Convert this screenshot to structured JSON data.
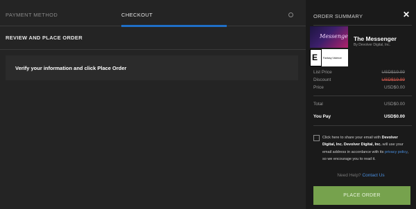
{
  "tabs": {
    "payment_method": "PAYMENT METHOD",
    "checkout": "CHECKOUT"
  },
  "main": {
    "section_title": "REVIEW AND PLACE ORDER",
    "verify_text": "Verify your information and click Place Order"
  },
  "summary": {
    "title": "ORDER SUMMARY",
    "close_icon": "close-icon",
    "product": {
      "title": "The Messenger",
      "publisher": "By Devolver Digital, Inc.",
      "cover_text": "Messenger",
      "esrb_rating": "E10+",
      "esrb_descriptor": "Fantasy Violence"
    },
    "prices": {
      "list_price_label": "List Price",
      "list_price_value": "USD$19.99",
      "discount_label": "Discount",
      "discount_value": "USD$19.99",
      "price_label": "Price",
      "price_value": "USD$0.00",
      "total_label": "Total",
      "total_value": "USD$0.00",
      "you_pay_label": "You Pay",
      "you_pay_value": "USD$0.00"
    },
    "consent": {
      "part1": "Click here to share your email with ",
      "company1": "Devolver Digital, Inc.",
      "part2": " ",
      "company2": "Devolver Digital, Inc.",
      "part3": " will use your email address in accordance with its ",
      "privacy_link": "privacy policy",
      "part4": ", so we encourage you to read it."
    },
    "help_text": "Need Help?",
    "help_link": "Contact Us",
    "place_order": "PLACE ORDER"
  },
  "colors": {
    "accent_blue": "#1f6fc8",
    "button_green": "#76a24d",
    "discount_red": "#c9564a"
  }
}
